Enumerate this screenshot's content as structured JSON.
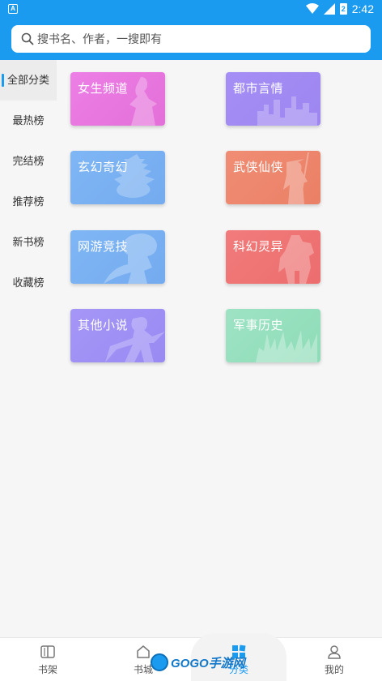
{
  "status": {
    "time": "2:42",
    "battery": "2"
  },
  "search": {
    "placeholder": "搜书名、作者，一搜即有"
  },
  "sidebar": {
    "items": [
      {
        "label": "全部分类",
        "active": true
      },
      {
        "label": "最热榜",
        "active": false
      },
      {
        "label": "完结榜",
        "active": false
      },
      {
        "label": "推荐榜",
        "active": false
      },
      {
        "label": "新书榜",
        "active": false
      },
      {
        "label": "收藏榜",
        "active": false
      }
    ]
  },
  "categories": [
    {
      "label": "女生频道",
      "color": "#ec7fe6",
      "color2": "#e46fd9",
      "icon": "girl-silhouette-icon"
    },
    {
      "label": "都市言情",
      "color": "#a58ef5",
      "color2": "#9d86f0",
      "icon": "city-skyline-icon"
    },
    {
      "label": "玄幻奇幻",
      "color": "#7fb6f4",
      "color2": "#74abf0",
      "icon": "pagoda-icon"
    },
    {
      "label": "武侠仙侠",
      "color": "#f08d74",
      "color2": "#ea8066",
      "icon": "swordsman-icon"
    },
    {
      "label": "网游竞技",
      "color": "#7fb6f4",
      "color2": "#74abf0",
      "icon": "gamer-silhouette-icon"
    },
    {
      "label": "科幻灵异",
      "color": "#f27b7b",
      "color2": "#ec6d6d",
      "icon": "robot-silhouette-icon"
    },
    {
      "label": "其他小说",
      "color": "#a596f7",
      "color2": "#988af2",
      "icon": "warrior-silhouette-icon"
    },
    {
      "label": "军事历史",
      "color": "#9de3c4",
      "color2": "#8fdcb8",
      "icon": "army-silhouette-icon"
    }
  ],
  "tabs": [
    {
      "label": "书架",
      "icon": "bookshelf-icon",
      "active": false
    },
    {
      "label": "书城",
      "icon": "home-icon",
      "active": false
    },
    {
      "label": "分类",
      "icon": "category-grid-icon",
      "active": true
    },
    {
      "label": "我的",
      "icon": "user-icon",
      "active": false
    }
  ],
  "watermark": {
    "text": "GOGO手游网"
  },
  "colors": {
    "accent": "#1a9bf0"
  }
}
